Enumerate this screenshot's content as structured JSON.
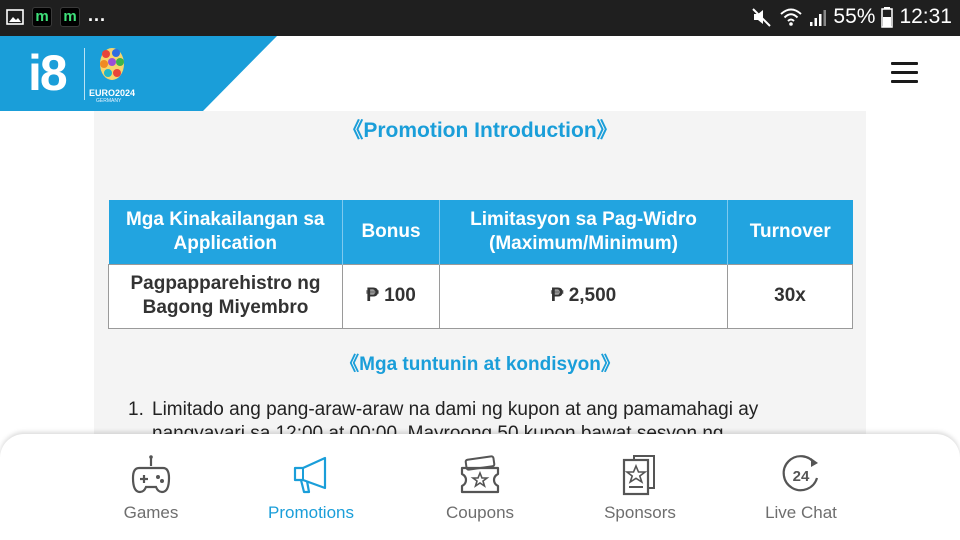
{
  "status_bar": {
    "app_badges": [
      "m",
      "m"
    ],
    "overflow": "...",
    "battery": "55%",
    "time": "12:31"
  },
  "header": {
    "logo_text": "i8",
    "euro_logo_text": "EURO2024",
    "euro_logo_subtext": "GERMANY",
    "brand_color": "#1a9ed9"
  },
  "content": {
    "intro_title": "《Promotion Introduction》",
    "table": {
      "headers": [
        "Mga Kinakailangan sa Application",
        "Bonus",
        "Limitasyon sa Pag-Widro (Maximum/Minimum)",
        "Turnover"
      ],
      "rows": [
        [
          "Pagpapparehistro ng Bagong Miyembro",
          "₱ 100",
          "₱ 2,500",
          "30x"
        ]
      ]
    },
    "terms_title": "《Mga tuntunin at kondisyon》",
    "rules": [
      {
        "num": "1.",
        "text": "Limitado ang pang-araw-araw na dami ng kupon at ang pamamahagi ay nangyayari sa 12:00 at 00:00. Mayroong 50 kupon bawat sesyon ng"
      }
    ]
  },
  "bottom_nav": {
    "active_color": "#1a9ed9",
    "items": [
      {
        "label": "Games",
        "icon": "gamepad-icon"
      },
      {
        "label": "Promotions",
        "icon": "megaphone-icon"
      },
      {
        "label": "Coupons",
        "icon": "coupon-icon"
      },
      {
        "label": "Sponsors",
        "icon": "sponsor-star-icon"
      },
      {
        "label": "Live Chat",
        "icon": "live-chat-24-icon",
        "icon_text": "24"
      }
    ]
  }
}
